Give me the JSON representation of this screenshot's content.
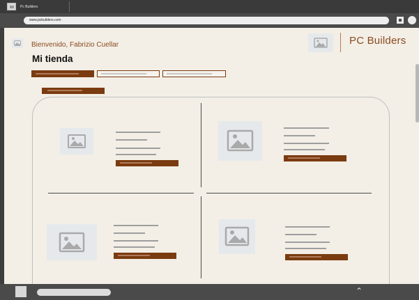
{
  "browser": {
    "tab_title": "Pc Builders",
    "url": "www.pcbuilders.com"
  },
  "header": {
    "welcome_text": "Bienvenido, Fabrizio Cuellar",
    "page_title": "Mi tienda",
    "brand_name": "PC Builders"
  },
  "icons": {
    "user": "image-placeholder-icon",
    "logo": "image-placeholder-icon",
    "product": "image-placeholder-icon",
    "window_toggle": "square-icon",
    "profile": "circle-icon",
    "scroll_up": "chevron-up-icon"
  },
  "bottom": {
    "chevron": "⌃"
  },
  "colors": {
    "accent": "#7a3b10",
    "brand_text": "#8a4a20",
    "page_bg": "#f3efe6",
    "chrome": "#4a4a4a"
  }
}
